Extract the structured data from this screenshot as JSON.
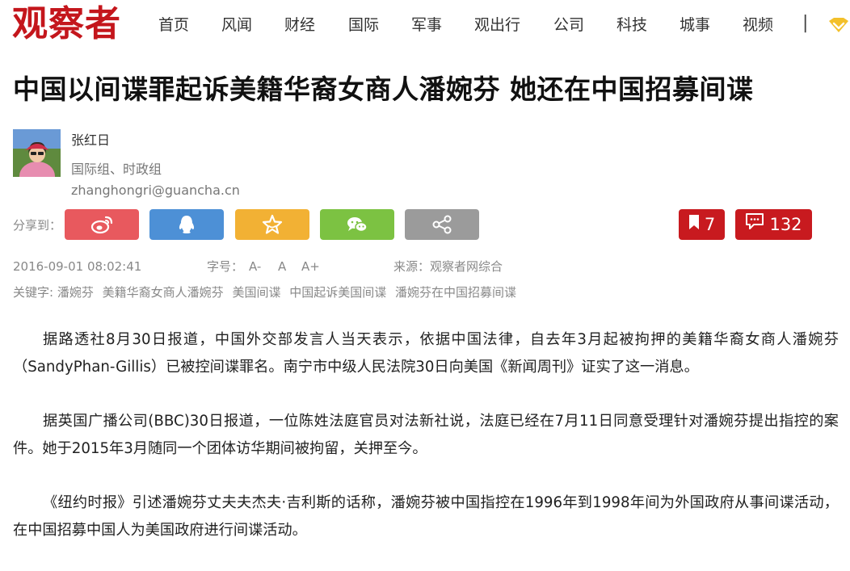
{
  "site": {
    "logo_text": "观察者",
    "nav": [
      "首页",
      "风闻",
      "财经",
      "国际",
      "军事",
      "观出行",
      "公司",
      "科技",
      "城事",
      "视频"
    ],
    "nav_separator": "|"
  },
  "article": {
    "title": "中国以间谍罪起诉美籍华裔女商人潘婉芬 她还在中国招募间谍",
    "author": {
      "name": "张红日",
      "dept": "国际组、时政组",
      "email": "zhanghongri@guancha.cn"
    },
    "share": {
      "label": "分享到：",
      "buttons": [
        {
          "icon": "weibo-icon",
          "color": "#e8595e"
        },
        {
          "icon": "qq-icon",
          "color": "#4d90d6"
        },
        {
          "icon": "star-icon",
          "color": "#f2b134"
        },
        {
          "icon": "wechat-icon",
          "color": "#7cc242"
        },
        {
          "icon": "share-icon",
          "color": "#9b9b9b"
        }
      ],
      "bookmark_count": "7",
      "comment_count": "132"
    },
    "meta": {
      "date": "2016-09-01 08:02:41",
      "font_label": "字号：",
      "font_options": [
        "A-",
        "A",
        "A+"
      ],
      "source": "来源：观察者网综合"
    },
    "keywords": {
      "label": "关键字:",
      "items": [
        "潘婉芬",
        "美籍华裔女商人潘婉芬",
        "美国间谍",
        "中国起诉美国间谍",
        "潘婉芬在中国招募间谍"
      ]
    },
    "paragraphs": [
      "据路透社8月30日报道，中国外交部发言人当天表示，依据中国法律，自去年3月起被拘押的美籍华裔女商人潘婉芬（SandyPhan-Gillis）已被控间谍罪名。南宁市中级人民法院30日向美国《新闻周刊》证实了这一消息。",
      "据英国广播公司(BBC)30日报道，一位陈姓法庭官员对法新社说，法庭已经在7月11日同意受理针对潘婉芬提出指控的案件。她于2015年3月随同一个团体访华期间被拘留，关押至今。",
      "《纽约时报》引述潘婉芬丈夫夫杰夫·吉利斯的话称，潘婉芬被中国指控在1996年到1998年间为外国政府从事间谍活动，在中国招募中国人为美国政府进行间谍活动。"
    ]
  },
  "colors": {
    "brand_red": "#c4161c",
    "count_red": "#c81a1f"
  }
}
